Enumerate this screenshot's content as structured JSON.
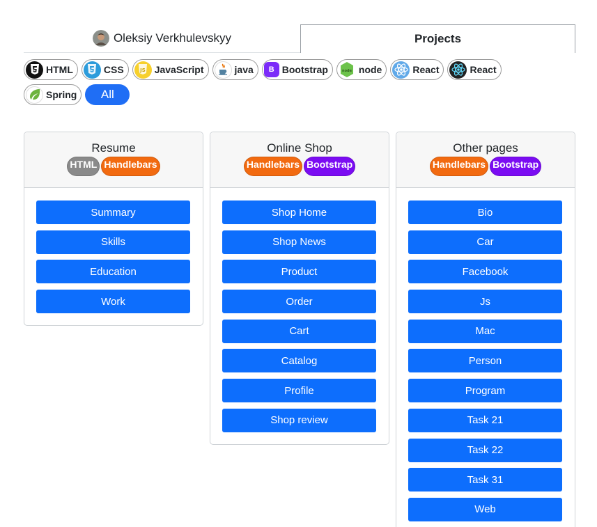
{
  "tabs": {
    "profile_label": "Oleksiy Verkhulevskyy",
    "projects_label": "Projects"
  },
  "filters": {
    "techs": [
      {
        "label": "HTML",
        "icon": "html5-icon",
        "color": "#111111"
      },
      {
        "label": "CSS",
        "icon": "css3-icon",
        "color": "#2d9cdb"
      },
      {
        "label": "JavaScript",
        "icon": "javascript-icon",
        "color": "#f7d02c"
      },
      {
        "label": "java",
        "icon": "java-icon",
        "color": "#e76f00"
      },
      {
        "label": "Bootstrap",
        "icon": "bootstrap-icon",
        "color": "#7b2bf9"
      },
      {
        "label": "node",
        "icon": "nodejs-icon",
        "color": "#6cc24a"
      },
      {
        "label": "React",
        "icon": "react-icon",
        "color": "#61dafb"
      },
      {
        "label": "React",
        "icon": "react-dark-icon",
        "color": "#222222"
      },
      {
        "label": "Spring",
        "icon": "spring-icon",
        "color": "#6db33f"
      }
    ],
    "all_label": "All"
  },
  "cards": [
    {
      "title": "Resume",
      "badges": [
        {
          "label": "HTML",
          "color": "#8a8a8a"
        },
        {
          "label": "Handlebars",
          "color": "#f26a10"
        }
      ],
      "links": [
        "Summary",
        "Skills",
        "Education",
        "Work"
      ]
    },
    {
      "title": "Online Shop",
      "badges": [
        {
          "label": "Handlebars",
          "color": "#f26a10"
        },
        {
          "label": "Bootstrap",
          "color": "#7b0cf2"
        }
      ],
      "links": [
        "Shop Home",
        "Shop News",
        "Product",
        "Order",
        "Cart",
        "Catalog",
        "Profile",
        "Shop review"
      ]
    },
    {
      "title": "Other pages",
      "badges": [
        {
          "label": "Handlebars",
          "color": "#f26a10"
        },
        {
          "label": "Bootstrap",
          "color": "#7b0cf2"
        }
      ],
      "links": [
        "Bio",
        "Car",
        "Facebook",
        "Js",
        "Mac",
        "Person",
        "Program",
        "Task 21",
        "Task 22",
        "Task 31",
        "Web"
      ]
    }
  ],
  "colors": {
    "accent": "#0d6efd",
    "all_button": "#1f6ef5"
  }
}
